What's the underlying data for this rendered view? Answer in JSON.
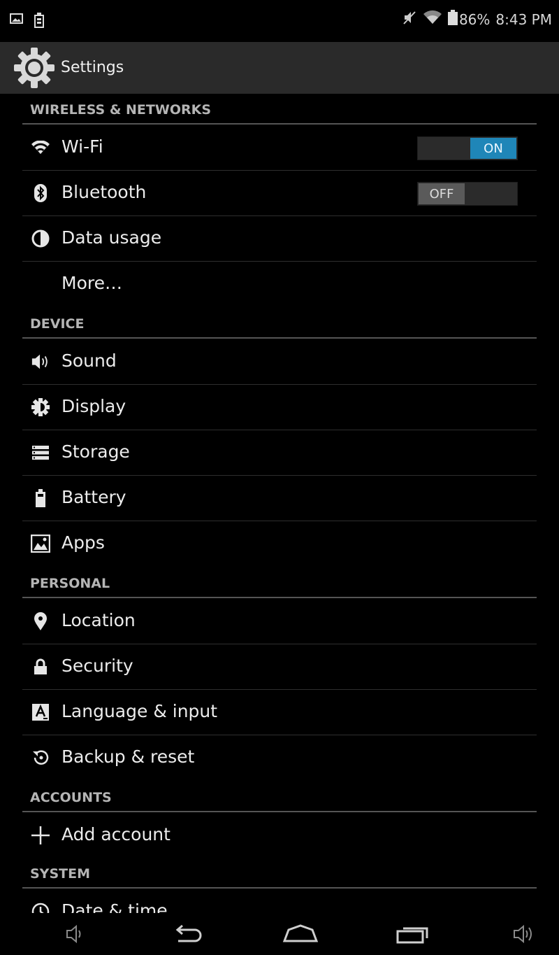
{
  "status_bar": {
    "battery_text": "86%",
    "time": "8:43 PM"
  },
  "action_bar": {
    "title": "Settings",
    "icon": "gear-icon"
  },
  "sections": [
    {
      "header": "WIRELESS & NETWORKS",
      "items": [
        {
          "label": "Wi-Fi",
          "icon": "wifi-icon",
          "toggle": "ON"
        },
        {
          "label": "Bluetooth",
          "icon": "bluetooth-icon",
          "toggle": "OFF"
        },
        {
          "label": "Data usage",
          "icon": "data-usage-icon"
        },
        {
          "label": "More…"
        }
      ]
    },
    {
      "header": "DEVICE",
      "items": [
        {
          "label": "Sound",
          "icon": "speaker-icon"
        },
        {
          "label": "Display",
          "icon": "brightness-icon"
        },
        {
          "label": "Storage",
          "icon": "storage-icon"
        },
        {
          "label": "Battery",
          "icon": "battery-icon"
        },
        {
          "label": "Apps",
          "icon": "apps-icon"
        }
      ]
    },
    {
      "header": "PERSONAL",
      "items": [
        {
          "label": "Location",
          "icon": "location-pin-icon"
        },
        {
          "label": "Security",
          "icon": "lock-icon"
        },
        {
          "label": "Language & input",
          "icon": "language-icon"
        },
        {
          "label": "Backup & reset",
          "icon": "backup-icon"
        }
      ]
    },
    {
      "header": "ACCOUNTS",
      "items": [
        {
          "label": "Add account",
          "icon": "plus-icon"
        }
      ]
    },
    {
      "header": "SYSTEM",
      "items": [
        {
          "label": "Date & time",
          "icon": "clock-icon"
        }
      ]
    }
  ],
  "colors": {
    "background": "#000000",
    "action_bar": "#2a2a2a",
    "toggle_on": "#1f86b8",
    "toggle_off": "#5a5a5a",
    "section_header_text": "#b5b5b5"
  }
}
